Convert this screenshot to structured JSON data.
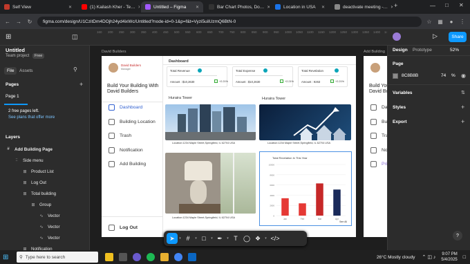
{
  "browser": {
    "tabs": [
      {
        "label": "Self View",
        "color": "#c0392b"
      },
      {
        "label": "(1) Kailash Kher - Te…",
        "color": "#ff0000"
      },
      {
        "label": "Untitled – Figma",
        "color": "#a259ff"
      },
      {
        "label": "Bar Chart Photos, Do…",
        "color": "#333"
      },
      {
        "label": "Location in USA",
        "color": "#1a73e8"
      },
      {
        "label": "deactivate meeting -…",
        "color": "#888"
      }
    ],
    "url": "figma.com/design/U1CzitDm4DOjh24yd4ixWc/Untitled?node-id=0-1&p=f&t=Vyzi5uilUzmQ6BtN-0"
  },
  "figma": {
    "file_title": "Untitled",
    "team": "Team project",
    "plan_badge": "Free",
    "tab_file": "File",
    "tab_assets": "Assets",
    "pages_header": "Pages",
    "page1": "Page 1",
    "pages_left": "2 free pages left.",
    "see_plans": "See plans that offer more",
    "layers_header": "Layers",
    "layers": [
      {
        "label": "Add Building Page",
        "indent": 0,
        "icon": "#"
      },
      {
        "label": "Side menu",
        "indent": 1,
        "icon": "::"
      },
      {
        "label": "Product List",
        "indent": 2,
        "icon": "⊞"
      },
      {
        "label": "Log Out",
        "indent": 2,
        "icon": "⊞"
      },
      {
        "label": "Total building",
        "indent": 2,
        "icon": "⊞"
      },
      {
        "label": "Group",
        "indent": 3,
        "icon": "⊞"
      },
      {
        "label": "Vector",
        "indent": 4,
        "icon": "∿"
      },
      {
        "label": "Vector",
        "indent": 4,
        "icon": "∿"
      },
      {
        "label": "Vector",
        "indent": 4,
        "icon": "∿"
      },
      {
        "label": "Notification",
        "indent": 2,
        "icon": "⊞"
      }
    ],
    "right": {
      "tab_design": "Design",
      "tab_prototype": "Prototype",
      "zoom": "52%",
      "share": "Share",
      "page_label": "Page",
      "page_color": "8C8B8B",
      "page_opacity": "74",
      "percent": "%",
      "variables": "Variables",
      "styles": "Styles",
      "export": "Export"
    },
    "ruler": [
      "160",
      "200",
      "250",
      "300",
      "350",
      "400",
      "450",
      "500",
      "550",
      "600",
      "650",
      "700",
      "750",
      "800",
      "850",
      "900",
      "950",
      "1000",
      "1050",
      "1100",
      "1150",
      "1200",
      "1250",
      "1300",
      "1350",
      "1400",
      "1450"
    ],
    "help": "?"
  },
  "design": {
    "frame_label": "David Builders",
    "frame_label2": "Add Building",
    "brand": "David Builders",
    "brand_sub": "Manager",
    "heading": "Build Your Building With David Builders",
    "menu": [
      "Dashboard",
      "Building Location",
      "Trash",
      "Notification",
      "Add Building"
    ],
    "logout": "Log Out",
    "dash_title": "Dashboard",
    "cards": [
      {
        "title": "Total Revenue",
        "amount": "Amount : $10,2630",
        "pct": "+2.21%"
      },
      {
        "title": "Total Expense",
        "amount": "Amount : $10,2630",
        "pct": "+2.21%"
      },
      {
        "title": "Total Revelation",
        "amount": "Amount : 9263",
        "pct": "+2.21%"
      }
    ],
    "tower1": "Huraira Tower",
    "tower2": "Huraira Tower",
    "loc1": "Location:1234 Maple Street,Springfield, IL 62704 USA",
    "loc2": "Location:1234 Maple Street,Springfield, IL 62704 USA",
    "loc3": "Location:1234 Maple Street,Springfield, IL 62704 USA",
    "second_menu": [
      "Das",
      "Buil",
      "Tras",
      "Noti",
      "Prin"
    ],
    "second_heading": "Build Your Building With David Builders"
  },
  "chart_data": {
    "type": "bar",
    "title": "Total Revelation In This Year",
    "categories": [
      "Jan",
      "Feb",
      "Mar",
      "Apr"
    ],
    "values": [
      3400,
      2400,
      6300,
      5100
    ],
    "colors": [
      "#e53935",
      "#e53935",
      "#c62828",
      "#1a2a5a"
    ],
    "yticks": [
      "10000",
      "8000",
      "6000",
      "4000",
      "2000",
      "0"
    ],
    "ylim": [
      0,
      10000
    ],
    "footer": "See All"
  },
  "taskbar": {
    "search": "Type here to search",
    "weather": "26°C Mostly cloudy",
    "time": "9:07 PM",
    "date": "5/4/2025"
  }
}
